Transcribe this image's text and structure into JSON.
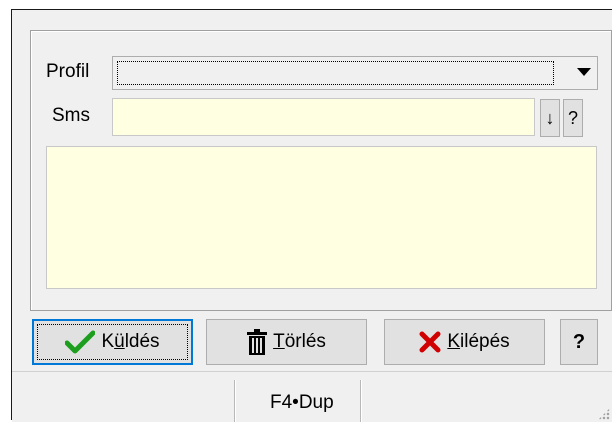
{
  "form": {
    "profil_label": "Profil",
    "profil_value": "",
    "sms_label": "Sms",
    "sms_value": "",
    "message_value": ""
  },
  "small_buttons": {
    "arrow": "↓",
    "help": "?"
  },
  "buttons": {
    "send_prefix": "K",
    "send_underlined": "ü",
    "send_suffix": "ldés",
    "delete_underlined": "T",
    "delete_suffix": "örlés",
    "exit_underlined": "K",
    "exit_suffix": "ilépés",
    "help": "?"
  },
  "status": {
    "text": "F4•Dup"
  },
  "colors": {
    "input_bg": "#ffffe1",
    "dialog_bg": "#f0f0f0",
    "focus_border": "#0078d7",
    "checkmark": "#1e9e1e",
    "exit_x": "#d00000"
  },
  "icons": {
    "send": "checkmark-icon",
    "delete": "trash-icon",
    "exit": "red-x-icon",
    "dropdown": "chevron-down-icon",
    "grip": "resize-grip-icon"
  }
}
